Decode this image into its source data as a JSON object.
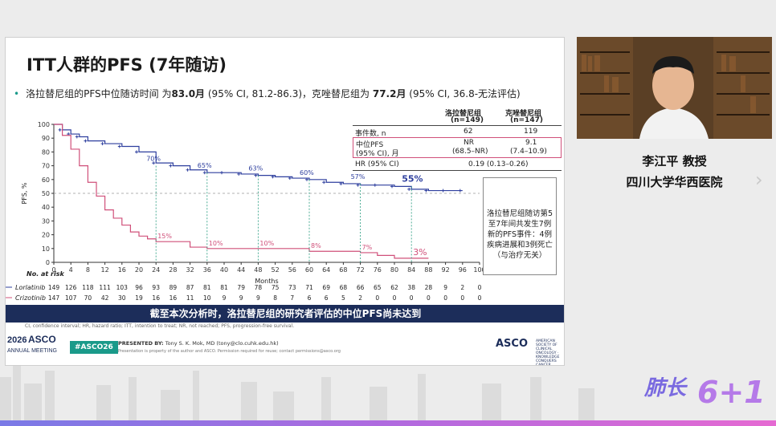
{
  "slide": {
    "title": "ITT人群的PFS (7年随访)",
    "bullet_prefix": "洛拉替尼组的PFS中位随访时间 为",
    "bullet_lor_value": "83.0月",
    "bullet_lor_ci": " (95% CI, 81.2-86.3)，克唑替尼组为 ",
    "bullet_criz_value": "77.2月",
    "bullet_criz_ci": " (95% CI, 36.8-无法评估)",
    "table": {
      "col1_header": "洛拉替尼组",
      "col1_sub": "(n=149)",
      "col2_header": "克唑替尼组",
      "col2_sub": "(n=147)",
      "row_events_label": "事件数, n",
      "row_events_lor": "62",
      "row_events_criz": "119",
      "row_median_label1": "中位PFS",
      "row_median_label2": "(95% CI), 月",
      "row_median_lor1": "NR",
      "row_median_lor2": "(68.5–NR)",
      "row_median_criz1": "9.1",
      "row_median_criz2": "(7.4–10.9)",
      "row_hr_label": "HR (95% CI)",
      "row_hr_value": "0.19 (0.13–0.26)"
    },
    "note_box": "洛拉替尼组随访第5至7年间共发生7例新的PFS事件：4例疾病进展和3例死亡（与治疗无关）",
    "banner": "截至本次分析时，洛拉替尼组的研究者评估的中位PFS尚未达到",
    "footnote": "CI, confidence interval; HR, hazard ratio; ITT, intention to treat; NR, not reached; PFS, progression-free survival.",
    "footer": {
      "meeting_year": "2026",
      "meeting_brand": "ASCO",
      "meeting_sub": "ANNUAL MEETING",
      "hashtag": "#ASCO26",
      "presented_by_label": "PRESENTED BY:",
      "presented_by": "Tony S. K. Mok, MD (tony@clo.cuhk.edu.hk)",
      "presented_sub": "Presentation is property of the author and ASCO. Permission required for reuse; contact permissions@asco.org",
      "asco_right": "ASCO",
      "asco_right_sub": "AMERICAN SOCIETY OF CLINICAL ONCOLOGY · KNOWLEDGE CONQUERS CANCER"
    }
  },
  "speaker": {
    "name": "李江平 教授",
    "org": "四川大学华西医院"
  },
  "brand": {
    "text": "肺长",
    "number": "6+1"
  },
  "colors": {
    "lorlatinib": "#2e3f9e",
    "crizotinib": "#d0507a",
    "banner": "#1c2d5a",
    "teal": "#1a9a8a",
    "green_dash": "#3aa58a"
  },
  "chart_data": {
    "type": "line",
    "title": "",
    "xlabel": "Months",
    "ylabel": "PFS, %",
    "xlim": [
      0,
      100
    ],
    "ylim": [
      0,
      100
    ],
    "x_ticks": [
      0,
      4,
      8,
      12,
      16,
      20,
      24,
      28,
      32,
      36,
      40,
      44,
      48,
      52,
      56,
      60,
      64,
      68,
      72,
      76,
      80,
      84,
      88,
      92,
      96,
      100
    ],
    "y_ticks": [
      0,
      10,
      20,
      30,
      40,
      50,
      60,
      70,
      80,
      90,
      100
    ],
    "reference_line_y": 50,
    "series": [
      {
        "name": "Lorlatinib",
        "x": [
          0,
          2,
          4,
          6,
          8,
          12,
          16,
          20,
          24,
          28,
          32,
          36,
          40,
          44,
          48,
          52,
          56,
          60,
          64,
          68,
          72,
          76,
          80,
          84,
          88,
          92,
          96
        ],
        "y": [
          100,
          96,
          93,
          91,
          88,
          86,
          84,
          80,
          72,
          70,
          67,
          65,
          65,
          64,
          63,
          62,
          61,
          60,
          58,
          57,
          56,
          56,
          55,
          53,
          52,
          52,
          52
        ]
      },
      {
        "name": "Crizotinib",
        "x": [
          0,
          2,
          4,
          6,
          8,
          10,
          12,
          14,
          16,
          18,
          20,
          22,
          24,
          28,
          32,
          36,
          40,
          48,
          56,
          60,
          64,
          72,
          76,
          80,
          84,
          88
        ],
        "y": [
          100,
          92,
          82,
          70,
          58,
          48,
          38,
          32,
          27,
          22,
          19,
          17,
          15,
          15,
          11,
          10,
          10,
          10,
          10,
          8,
          8,
          7,
          5,
          3,
          3,
          3
        ]
      }
    ],
    "annotations": [
      {
        "x": 24,
        "y": 70,
        "label": "70%",
        "series": "Lorlatinib"
      },
      {
        "x": 36,
        "y": 65,
        "label": "65%",
        "series": "Lorlatinib"
      },
      {
        "x": 48,
        "y": 63,
        "label": "63%",
        "series": "Lorlatinib"
      },
      {
        "x": 60,
        "y": 60,
        "label": "60%",
        "series": "Lorlatinib"
      },
      {
        "x": 72,
        "y": 57,
        "label": "57%",
        "series": "Lorlatinib"
      },
      {
        "x": 84,
        "y": 55,
        "label": "55%",
        "series": "Lorlatinib"
      },
      {
        "x": 24,
        "y": 15,
        "label": "15%",
        "series": "Crizotinib"
      },
      {
        "x": 36,
        "y": 10,
        "label": "10%",
        "series": "Crizotinib"
      },
      {
        "x": 48,
        "y": 10,
        "label": "10%",
        "series": "Crizotinib"
      },
      {
        "x": 60,
        "y": 8,
        "label": "8%",
        "series": "Crizotinib"
      },
      {
        "x": 72,
        "y": 7,
        "label": "7%",
        "series": "Crizotinib"
      },
      {
        "x": 84,
        "y": 3,
        "label": "3%",
        "series": "Crizotinib"
      }
    ],
    "at_risk_label": "No. at risk",
    "at_risk": [
      {
        "name": "Lorlatinib",
        "values": [
          "149",
          "126",
          "118",
          "111",
          "103",
          "96",
          "93",
          "89",
          "87",
          "81",
          "81",
          "79",
          "78",
          "75",
          "73",
          "71",
          "69",
          "68",
          "66",
          "65",
          "62",
          "38",
          "28",
          "9",
          "2",
          "0"
        ]
      },
      {
        "name": "Crizotinib",
        "values": [
          "147",
          "107",
          "70",
          "42",
          "30",
          "19",
          "16",
          "16",
          "11",
          "10",
          "9",
          "9",
          "9",
          "8",
          "7",
          "6",
          "6",
          "5",
          "2",
          "0",
          "0",
          "0",
          "0",
          "0",
          "0",
          "0"
        ]
      }
    ]
  }
}
